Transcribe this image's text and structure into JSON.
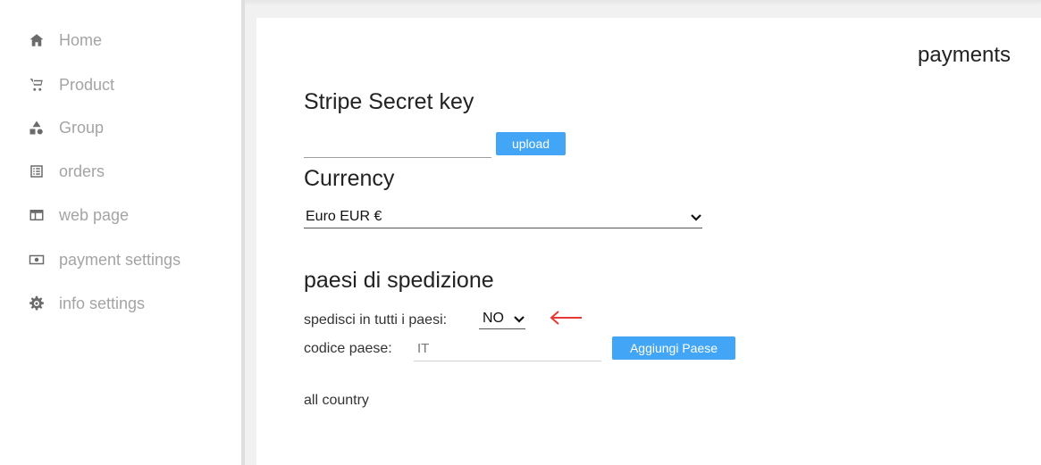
{
  "sidebar": {
    "items": [
      {
        "label": "Home",
        "icon": "home-icon"
      },
      {
        "label": "Product",
        "icon": "cart-icon"
      },
      {
        "label": "Group",
        "icon": "shapes-icon"
      },
      {
        "label": "orders",
        "icon": "list-icon"
      },
      {
        "label": "web page",
        "icon": "webpage-icon"
      },
      {
        "label": "payment settings",
        "icon": "money-icon"
      },
      {
        "label": "info settings",
        "icon": "gear-icon"
      }
    ]
  },
  "main": {
    "title": "payments",
    "stripe": {
      "heading": "Stripe Secret key",
      "value": "",
      "upload_label": "upload"
    },
    "currency": {
      "heading": "Currency",
      "selected": "Euro EUR €"
    },
    "shipping": {
      "heading": "paesi di spedizione",
      "all_countries_label": "spedisci in tutti i paesi:",
      "all_countries_value": "NO",
      "country_code_label": "codice paese:",
      "country_code_value": "IT",
      "add_country_label": "Aggiungi Paese",
      "countries_text": "all country"
    }
  },
  "colors": {
    "button": "#42a5f5",
    "arrow": "#e53935",
    "sidebar_text": "#a4a4a4"
  }
}
